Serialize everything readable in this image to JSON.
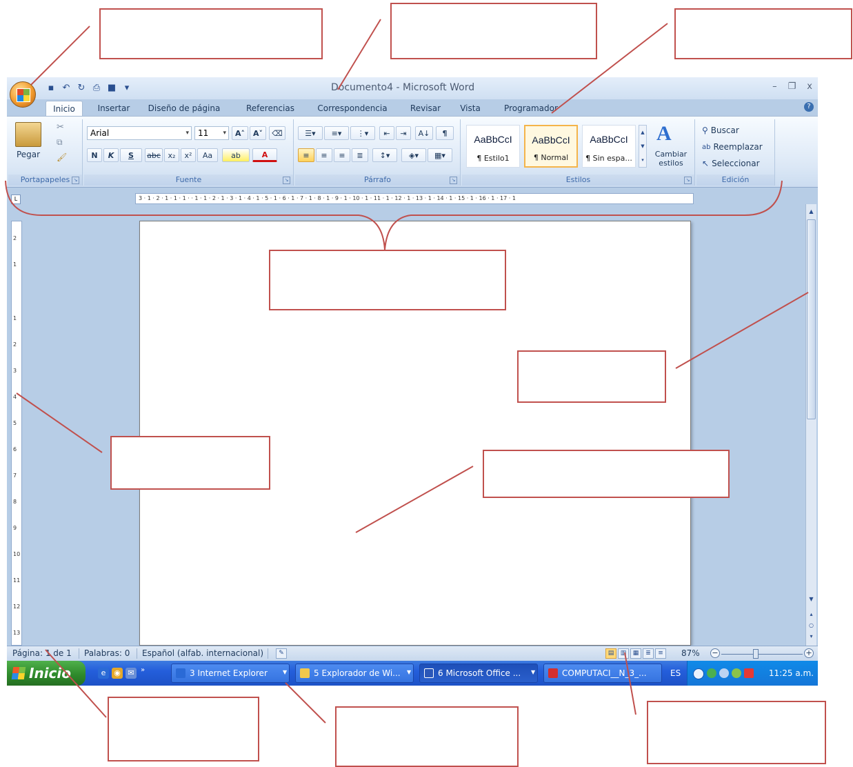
{
  "window": {
    "title": "Documento4 - Microsoft Word",
    "minimize": "–",
    "restore": "❐",
    "close": "x"
  },
  "quick_access": {
    "icons": [
      "save-icon",
      "undo-icon",
      "redo-icon",
      "print-preview-icon",
      "stop-icon",
      "customize-icon"
    ]
  },
  "tabs": [
    {
      "label": "Inicio",
      "active": true
    },
    {
      "label": "Insertar"
    },
    {
      "label": "Diseño de página"
    },
    {
      "label": "Referencias"
    },
    {
      "label": "Correspondencia"
    },
    {
      "label": "Revisar"
    },
    {
      "label": "Vista"
    },
    {
      "label": "Programador"
    }
  ],
  "ribbon": {
    "clipboard": {
      "group_label": "Portapapeles",
      "paste_label": "Pegar"
    },
    "font": {
      "group_label": "Fuente",
      "font_name": "Arial",
      "font_size": "11",
      "bold": "N",
      "italic": "K",
      "underline": "S",
      "strike": "abc",
      "subscript": "x₂",
      "superscript": "x²",
      "change_case": "Aa",
      "grow": "A˄",
      "shrink": "A˅",
      "highlight": "ab",
      "font_color": "A"
    },
    "paragraph": {
      "group_label": "Párrafo",
      "show_marks": "¶",
      "sort": "A↓"
    },
    "styles": {
      "group_label": "Estilos",
      "items": [
        {
          "preview": "AaBbCcI",
          "name": "¶ Estilo1"
        },
        {
          "preview": "AaBbCcI",
          "name": "¶ Normal",
          "selected": true
        },
        {
          "preview": "AaBbCcI",
          "name": "¶ Sin espa..."
        }
      ],
      "change_styles": "Cambiar estilos"
    },
    "editing": {
      "group_label": "Edición",
      "find": "Buscar",
      "replace": "Reemplazar",
      "select": "Seleccionar"
    }
  },
  "ruler": {
    "horizontal": "3 · 1 · 2 · 1 · 1 · 1 · · 1 · 1 · 2 · 1 · 3 · 1 · 4 · 1 · 5 · 1 · 6 · 1 · 7 · 1 · 8 · 1 · 9 · 1 · 10 · 1 · 11 · 1 · 12 · 1 · 13 · 1 · 14 · 1 · 15 · 1 · 16 · 1 · 17 · 1",
    "vertical": [
      "2",
      "1",
      "1",
      "2",
      "3",
      "4",
      "5",
      "6",
      "7",
      "8",
      "9",
      "10",
      "11",
      "12",
      "13"
    ]
  },
  "status": {
    "page": "Página: 1 de 1",
    "words": "Palabras: 0",
    "language": "Español (alfab. internacional)",
    "zoom": "87%",
    "zoom_minus": "−",
    "zoom_plus": "+"
  },
  "taskbar": {
    "start": "Inicio",
    "buttons": [
      {
        "label": "3 Internet Explorer"
      },
      {
        "label": "5 Explorador de Wi..."
      },
      {
        "label": "6 Microsoft Office ...",
        "active": true
      },
      {
        "label": "COMPUTACI__N_3_..."
      }
    ],
    "language": "ES",
    "clock": "11:25 a.m."
  },
  "colors": {
    "callout_border": "#c0504d",
    "taskbar_blue": "#245edb",
    "start_green": "#2f8b2c",
    "ribbon_bg": "#dce8f6"
  }
}
